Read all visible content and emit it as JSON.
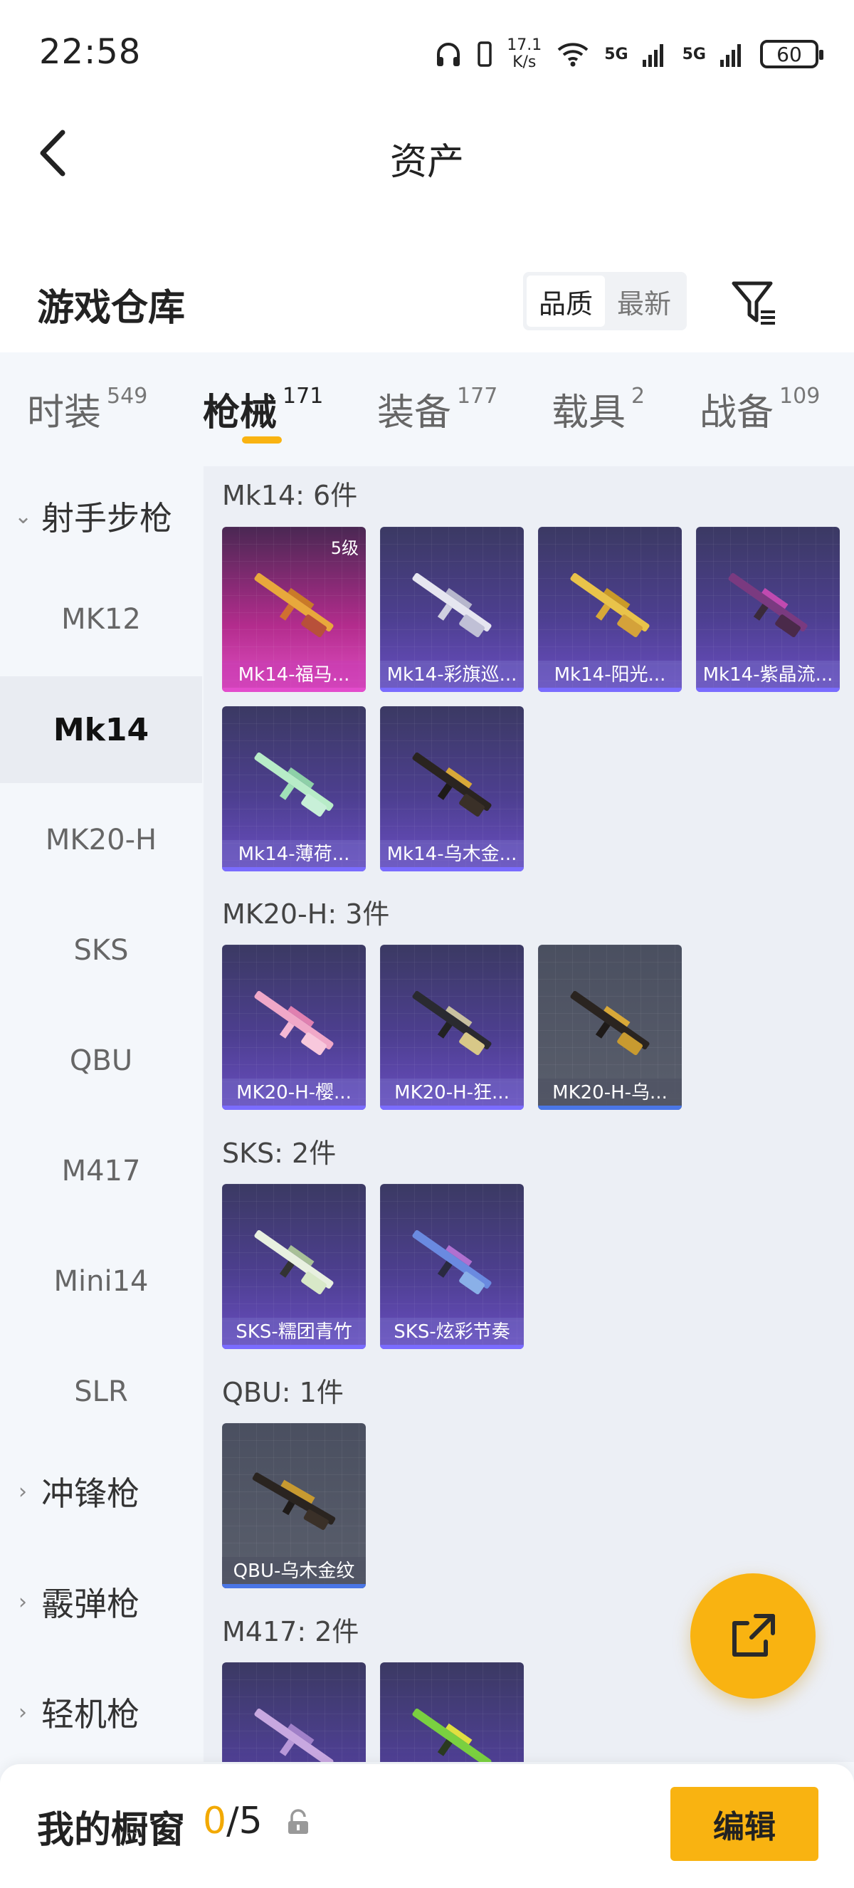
{
  "status_bar": {
    "time": "22:58",
    "net_speed_value": "17.1",
    "net_speed_unit": "K/s",
    "signal1": "5G",
    "signal2": "5G",
    "battery": "60"
  },
  "nav": {
    "title": "资产",
    "back_icon": "chevron-left-icon"
  },
  "warehouse": {
    "title": "游戏仓库",
    "sort_options": [
      "品质",
      "最新"
    ],
    "sort_selected": "品质",
    "filter_icon": "filter-icon"
  },
  "tabs": [
    {
      "label": "时装",
      "count": "549"
    },
    {
      "label": "枪械",
      "count": "171",
      "active": true
    },
    {
      "label": "装备",
      "count": "177"
    },
    {
      "label": "载具",
      "count": "2"
    },
    {
      "label": "战备",
      "count": "109"
    }
  ],
  "sidebar": {
    "category_open": "射手步枪",
    "items": [
      "MK12",
      "Mk14",
      "MK20-H",
      "SKS",
      "QBU",
      "M417",
      "Mini14",
      "SLR"
    ],
    "active_item": "Mk14",
    "collapsed_categories": [
      "冲锋枪",
      "霰弹枪",
      "轻机枪"
    ]
  },
  "groups": [
    {
      "title": "Mk14: 6件",
      "items": [
        {
          "name": "Mk14-福马...",
          "quality": "pink",
          "level": "5级"
        },
        {
          "name": "Mk14-彩旗巡...",
          "quality": "purple"
        },
        {
          "name": "Mk14-阳光...",
          "quality": "purple"
        },
        {
          "name": "Mk14-紫晶流...",
          "quality": "purple"
        },
        {
          "name": "Mk14-薄荷...",
          "quality": "purple"
        },
        {
          "name": "Mk14-乌木金...",
          "quality": "purple"
        }
      ]
    },
    {
      "title": "MK20-H: 3件",
      "items": [
        {
          "name": "MK20-H-樱...",
          "quality": "purple"
        },
        {
          "name": "MK20-H-狂...",
          "quality": "purple"
        },
        {
          "name": "MK20-H-乌...",
          "quality": "gray"
        }
      ]
    },
    {
      "title": "SKS: 2件",
      "items": [
        {
          "name": "SKS-糯团青竹",
          "quality": "purple"
        },
        {
          "name": "SKS-炫彩节奏",
          "quality": "purple"
        }
      ]
    },
    {
      "title": "QBU: 1件",
      "items": [
        {
          "name": "QBU-乌木金纹",
          "quality": "gray"
        }
      ]
    },
    {
      "title": "M417: 2件",
      "items": [
        {
          "name": "",
          "quality": "purple"
        },
        {
          "name": "",
          "quality": "purple"
        }
      ]
    }
  ],
  "fab_icon": "share-external-icon",
  "bottom_bar": {
    "title": "我的橱窗",
    "current": "0",
    "max": "/5",
    "lock_icon": "lock-icon",
    "edit_label": "编辑"
  },
  "colors": {
    "accent": "#f9b311",
    "quality_purple": "#6a4ec2",
    "quality_pink": "#e14fc4"
  }
}
